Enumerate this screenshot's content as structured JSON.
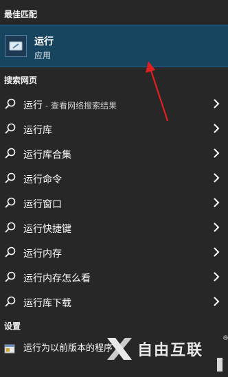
{
  "sections": {
    "best_match": "最佳匹配",
    "web_search": "搜索网页",
    "settings": "设置"
  },
  "best_match_item": {
    "title": "运行",
    "subtitle": "应用",
    "icon": "run-app-icon"
  },
  "web_results": [
    {
      "text": "运行",
      "hint": " - 查看网络搜索结果"
    },
    {
      "text": "运行库",
      "hint": ""
    },
    {
      "text": "运行库合集",
      "hint": ""
    },
    {
      "text": "运行命令",
      "hint": ""
    },
    {
      "text": "运行窗口",
      "hint": ""
    },
    {
      "text": "运行快捷键",
      "hint": ""
    },
    {
      "text": "运行内存",
      "hint": ""
    },
    {
      "text": "运行内存怎么看",
      "hint": ""
    },
    {
      "text": "运行库下载",
      "hint": ""
    }
  ],
  "settings_item": {
    "text": "运行为以前版本的程序"
  },
  "watermark": {
    "text": "自由互联",
    "reg": "®"
  },
  "colors": {
    "background": "#272727",
    "highlight": "#17445f",
    "arrow": "#e02020"
  }
}
